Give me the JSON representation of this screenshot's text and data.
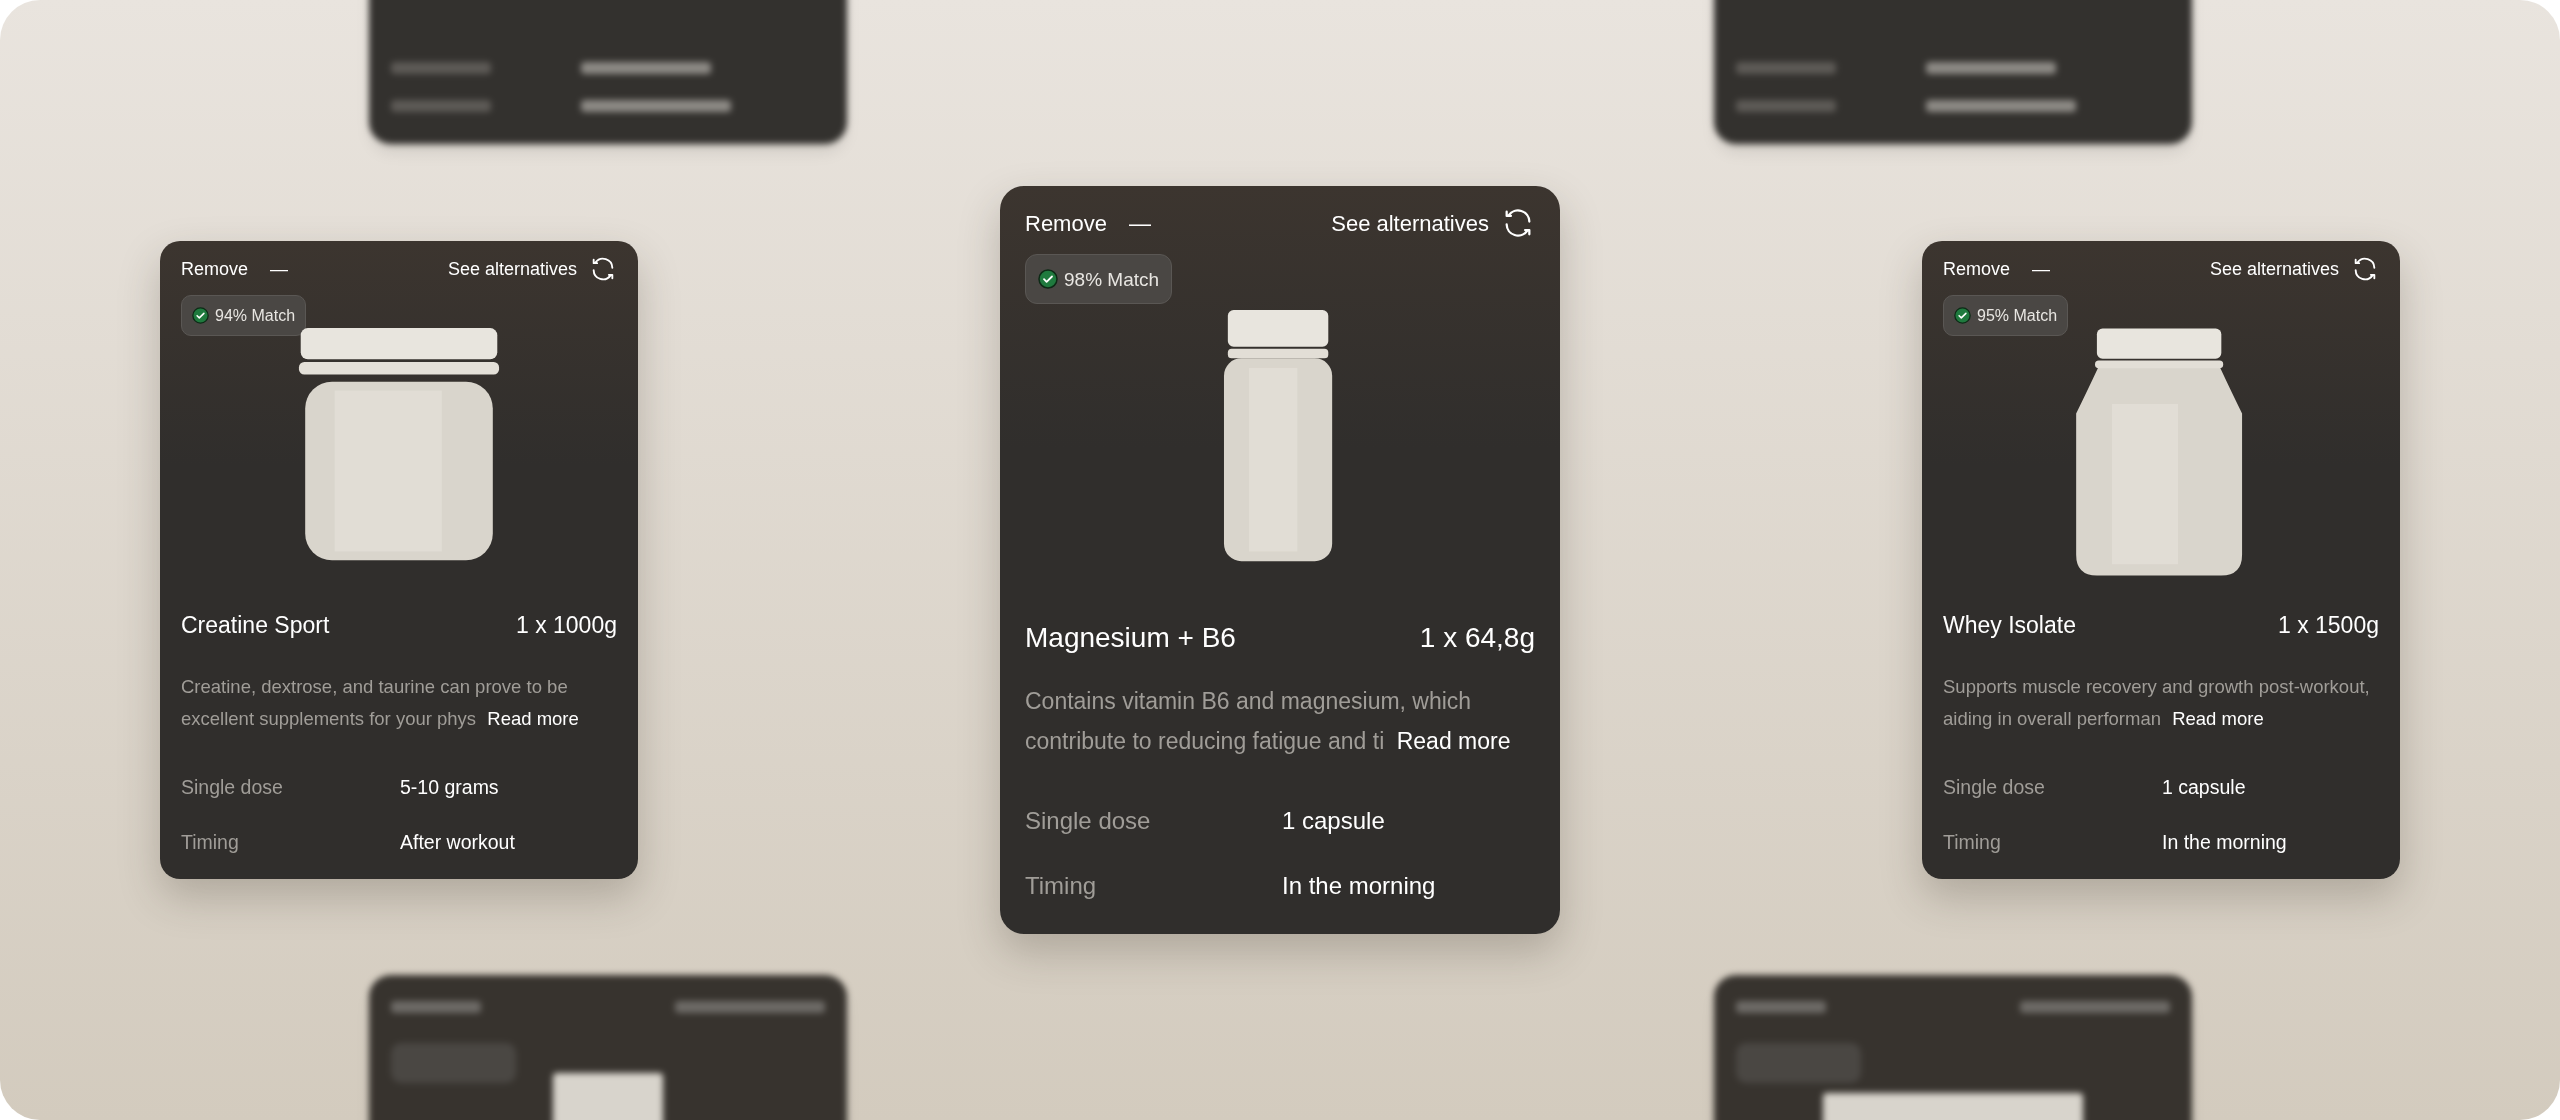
{
  "cards": [
    {
      "kind": "standard",
      "image": {
        "kind": "tub"
      },
      "remove": "Remove",
      "remove_symbol": "—",
      "alternatives": "See alternatives",
      "match": "94% Match",
      "name": "Creatine Sport",
      "quantity": "1 x 1000g",
      "description": "Creatine, dextrose, and taurine can prove to be excellent supplements for your phys",
      "read_more": "Read more",
      "details": [
        {
          "label": "Single dose",
          "value": "5-10 grams"
        },
        {
          "label": "Timing",
          "value": "After workout"
        }
      ]
    },
    {
      "kind": "featured",
      "image": {
        "kind": "bottle"
      },
      "remove": "Remove",
      "remove_symbol": "—",
      "alternatives": "See alternatives",
      "match": "98% Match",
      "name": "Magnesium + B6",
      "quantity": "1 x 64,8g",
      "description": "Contains vitamin B6 and magnesium, which contribute to reducing fatigue and ti",
      "read_more": "Read more",
      "details": [
        {
          "label": "Single dose",
          "value": "1 capsule"
        },
        {
          "label": "Timing",
          "value": "In the morning"
        }
      ]
    },
    {
      "kind": "standard",
      "image": {
        "kind": "jar"
      },
      "remove": "Remove",
      "remove_symbol": "—",
      "alternatives": "See alternatives",
      "match": "95% Match",
      "name": "Whey Isolate",
      "quantity": "1 x 1500g",
      "description": "Supports muscle recovery and growth post-workout, aiding in overall performan",
      "read_more": "Read more",
      "details": [
        {
          "label": "Single dose",
          "value": "1 capsule"
        },
        {
          "label": "Timing",
          "value": "In the morning"
        }
      ]
    }
  ]
}
